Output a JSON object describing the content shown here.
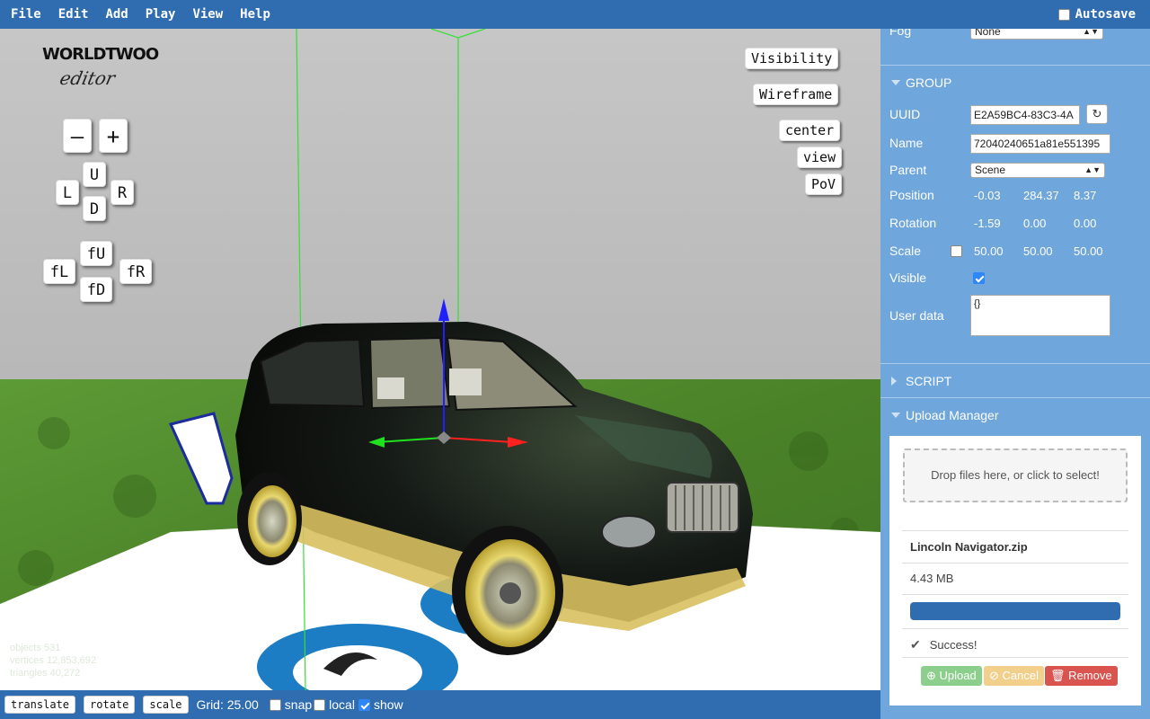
{
  "menubar": {
    "items": [
      "File",
      "Edit",
      "Add",
      "Play",
      "View",
      "Help"
    ],
    "autosave_label": "Autosave",
    "autosave_checked": false
  },
  "viewport": {
    "logo": {
      "title": "WORLDTWOO",
      "subtitle": "editor"
    },
    "zoom": {
      "minus": "–",
      "plus": "+"
    },
    "pan": {
      "up": "U",
      "left": "L",
      "right": "R",
      "down": "D"
    },
    "fly": {
      "up": "fU",
      "left": "fL",
      "right": "fR",
      "down": "fD"
    },
    "right_buttons": {
      "visibility": "Visibility",
      "wireframe": "Wireframe",
      "center": "center",
      "view": "view",
      "pov": "PoV"
    },
    "stats": {
      "objects": "objects 531",
      "vertices": "vertices 12,853,692",
      "triangles": "triangles 40,272"
    }
  },
  "bottombar": {
    "translate": "translate",
    "rotate": "rotate",
    "scale": "scale",
    "grid": "Grid: 25.00",
    "snap": "snap",
    "snap_checked": false,
    "local": "local",
    "local_checked": false,
    "show": "show",
    "show_checked": true
  },
  "panel": {
    "fog": {
      "label": "Fog",
      "value": "None"
    },
    "group": {
      "title": "GROUP",
      "uuid_label": "UUID",
      "uuid_value": "E2A59BC4-83C3-4A",
      "name_label": "Name",
      "name_value": "72040240651a81e551395",
      "parent_label": "Parent",
      "parent_value": "Scene",
      "position_label": "Position",
      "position": [
        "-0.03",
        "284.37",
        "8.37"
      ],
      "rotation_label": "Rotation",
      "rotation": [
        "-1.59",
        "0.00",
        "0.00"
      ],
      "scale_label": "Scale",
      "scale_lock_checked": false,
      "scale": [
        "50.00",
        "50.00",
        "50.00"
      ],
      "visible_label": "Visible",
      "visible_checked": true,
      "userdata_label": "User data",
      "userdata_value": "{}"
    },
    "script": {
      "title": "SCRIPT"
    },
    "upload": {
      "title": "Upload Manager",
      "drop_text": "Drop files here, or click to select!",
      "file_name": "Lincoln Navigator.zip",
      "file_size": "4.43 MB",
      "progress": 1.0,
      "status": "Success!",
      "upload_btn": "Upload",
      "cancel_btn": "Cancel",
      "remove_btn": "Remove"
    }
  },
  "colors": {
    "menubar": "#2f6db0",
    "panel": "#6fa6dc",
    "grass": "#4f8a2c",
    "floor": "#ffffff",
    "logo_blue": "#1c7cc4"
  }
}
